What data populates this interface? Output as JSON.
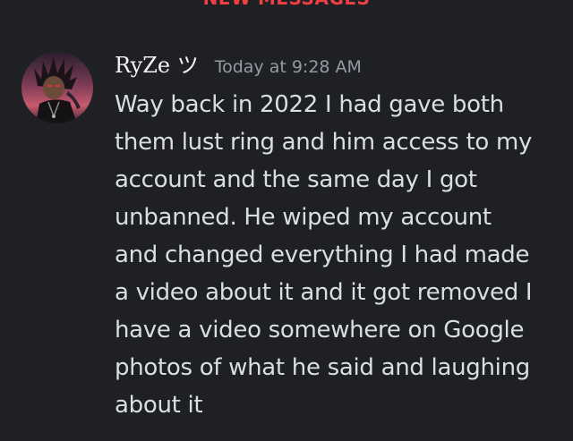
{
  "divider": {
    "label": "NEW MESSAGES"
  },
  "message": {
    "author": "RyZe ツ",
    "timestamp": "Today at 9:28 AM",
    "lines": [
      "Way back in 2022 I had gave both",
      "them lust ring and him access to my",
      "account and the same day I got",
      "unbanned. He wiped my account",
      "and changed everything I had made",
      "a video about it and it got removed I",
      "have a video somewhere on Google",
      "photos of what he said and laughing",
      "about it"
    ]
  },
  "colors": {
    "background": "#1f2024",
    "divider": "#f23f43",
    "author": "#f2f3f5",
    "timestamp": "#949ba4",
    "text": "#dbdee1"
  }
}
